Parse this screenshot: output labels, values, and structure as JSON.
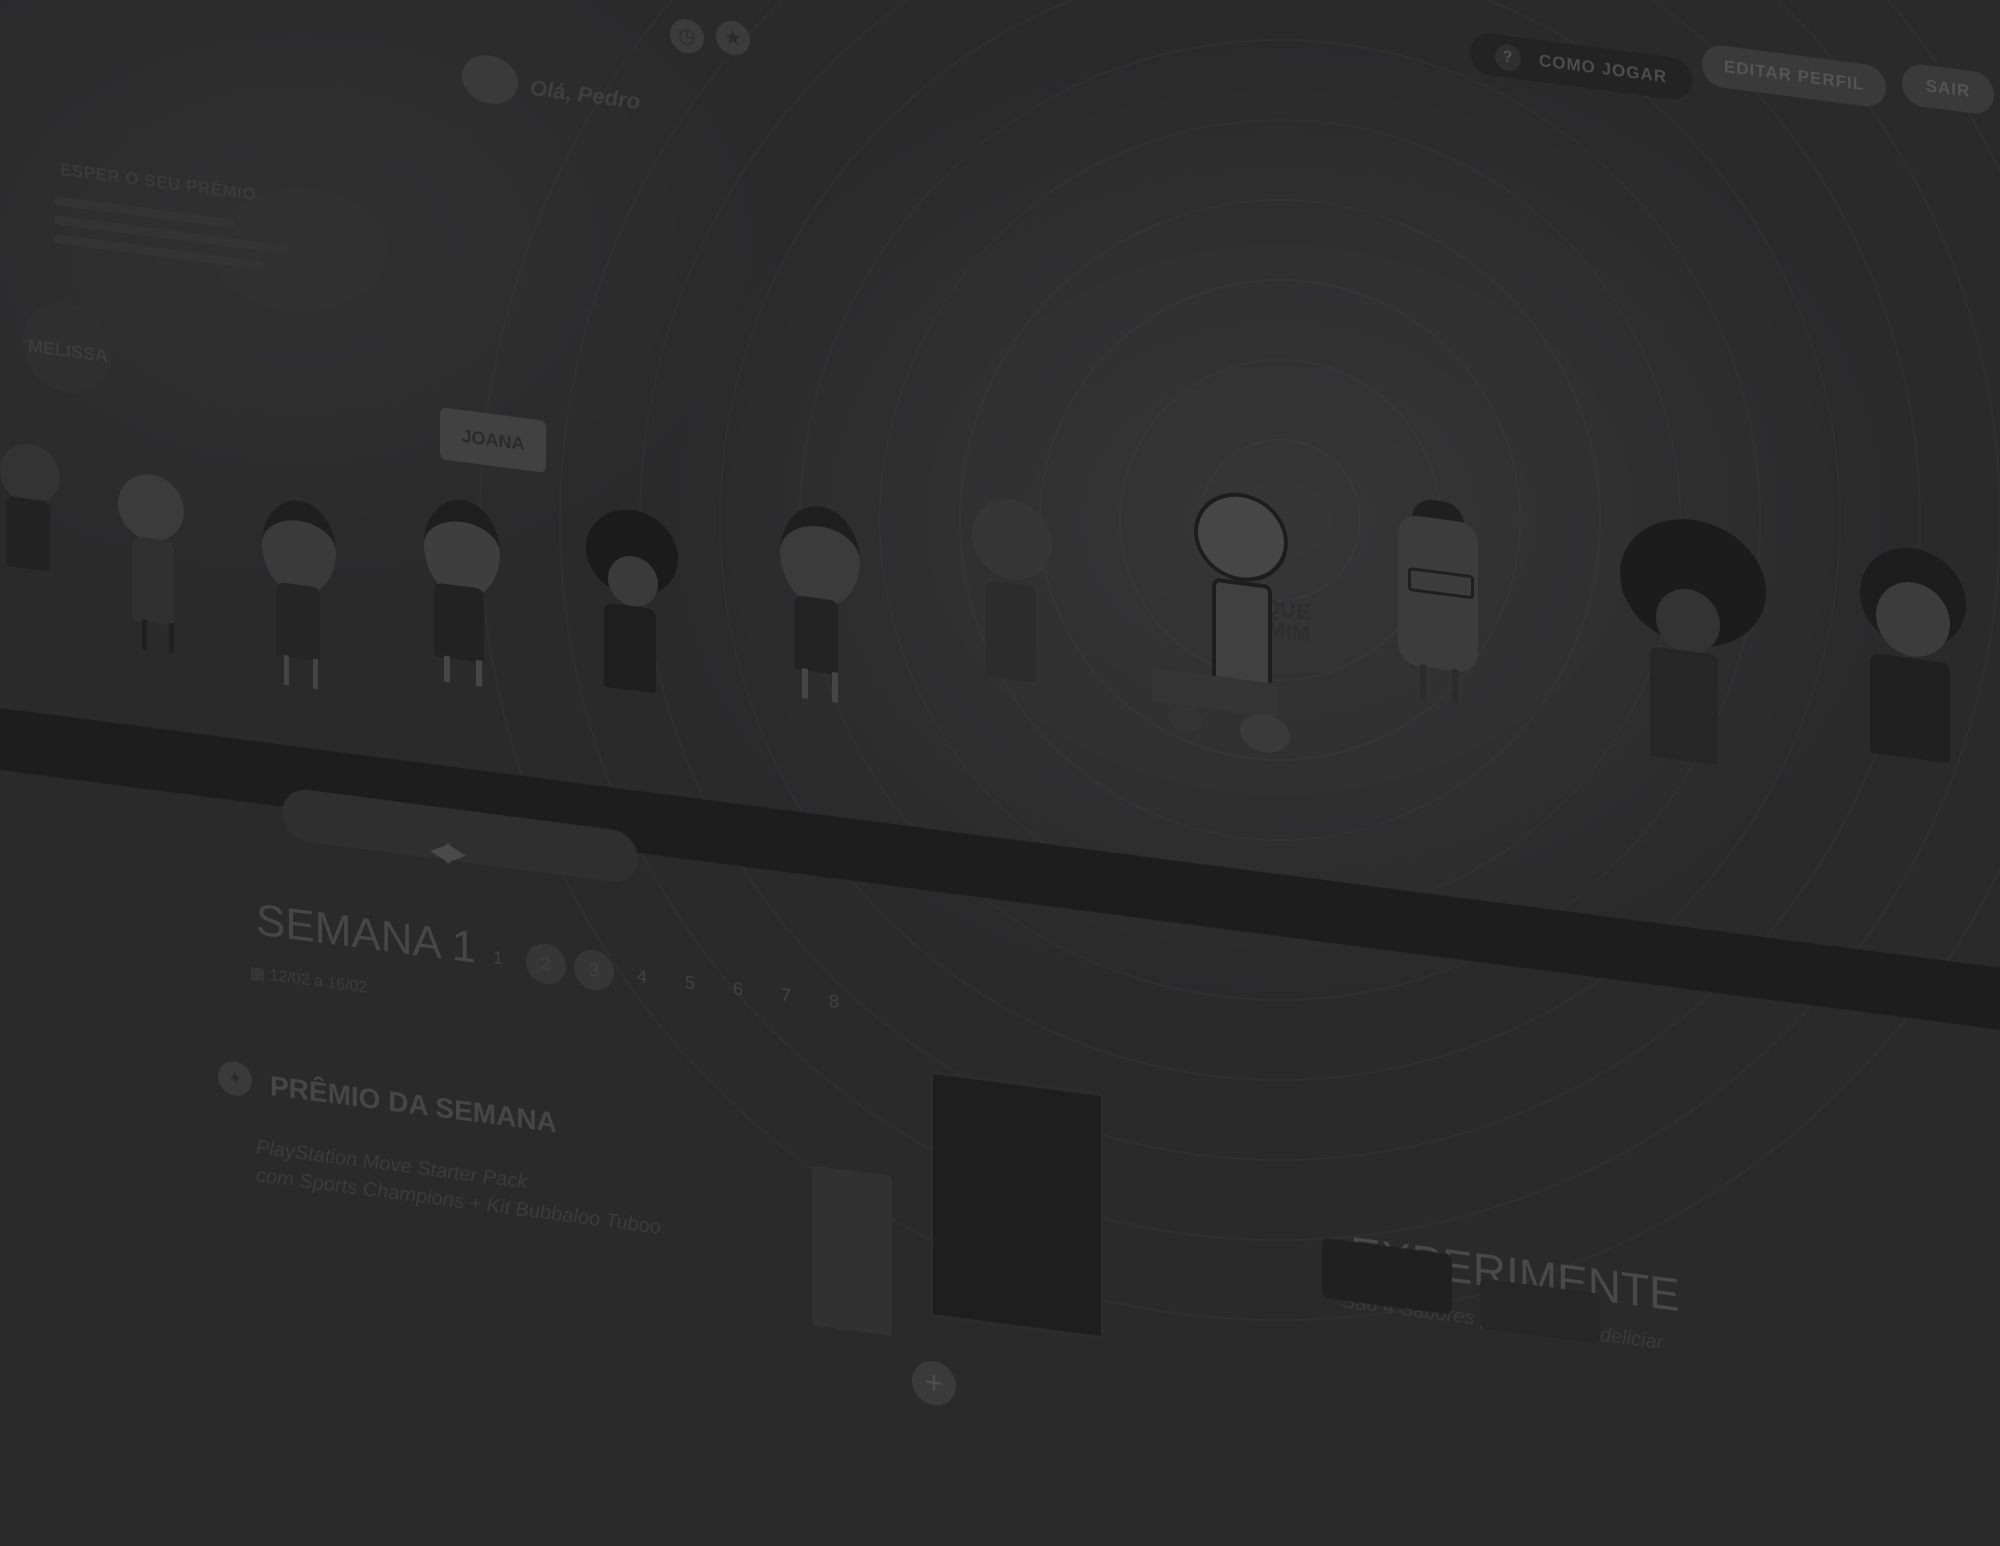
{
  "header": {
    "greeting": "Olá, Pedro",
    "clock_icon": "clock-icon",
    "star_icon": "star-icon",
    "how_to_play": "COMO JOGAR",
    "edit_profile": "EDITAR PERFIL",
    "logout": "SAIR"
  },
  "intro": {
    "title": "ESPER O SEU PRÊMIO"
  },
  "characters": {
    "melissa": "MELISSA",
    "joana": "JOANA",
    "click_me": "CLIQUE EM MIM"
  },
  "week": {
    "title": "SEMANA 1",
    "dates": "12/02 a 16/02",
    "pages": [
      "1",
      "2",
      "3",
      "4",
      "5",
      "6",
      "7",
      "8"
    ],
    "current_page": "1"
  },
  "prize": {
    "title": "PRÊMIO DA SEMANA",
    "line1": "PlayStation Move Starter Pack",
    "line2": "com Sports Champions + Kit Bubbaloo Tuboo"
  },
  "experiment": {
    "title": "EXPERIMENTE",
    "subtitle": "São 4 Sabores para você se deliciar"
  },
  "colors": {
    "background": "#2a2a2b",
    "bar": "#1d1d1e"
  }
}
